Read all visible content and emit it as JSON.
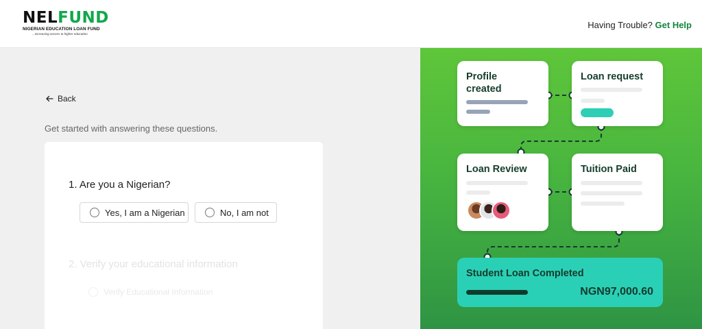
{
  "header": {
    "logo_part1": "NEL",
    "logo_part2": "FUND",
    "logo_subtitle": "NIGERIAN EDUCATION LOAN FUND",
    "logo_tagline": "...increasing access to higher education",
    "help_text": "Having Trouble?",
    "help_link": "Get Help"
  },
  "form": {
    "back_label": "Back",
    "intro": "Get started with answering these questions.",
    "question1": "1. Are you a Nigerian?",
    "option_yes": "Yes, I am a Nigerian",
    "option_no": "No, I am not",
    "question2": "2. Verify your educational information",
    "option_verify": "Verify Educational Information"
  },
  "steps": {
    "profile": "Profile created",
    "loan_request": "Loan request",
    "loan_review": "Loan Review",
    "tuition_paid": "Tuition Paid",
    "completed": "Student Loan Completed",
    "amount": "NGN97,000.60"
  },
  "colors": {
    "brand_green": "#11a84a",
    "panel_green": "#48b53f",
    "teal": "#2ad0b6"
  }
}
